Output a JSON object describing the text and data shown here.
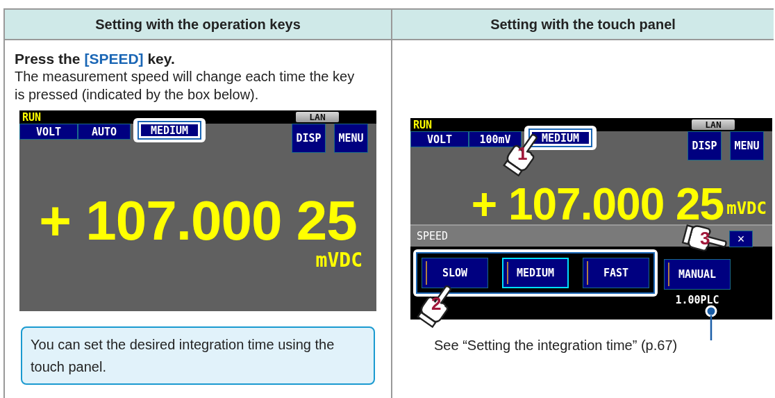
{
  "table": {
    "columns": [
      "Setting with the operation keys",
      "Setting with the touch panel"
    ]
  },
  "left": {
    "instruction": {
      "before": "Press the",
      "key": "[SPEED]",
      "after": "key."
    },
    "description": "The measurement speed will change each time the key is pressed (indicated by the box below).",
    "screen": {
      "status": "RUN",
      "lan": "LAN",
      "tabs": [
        {
          "label": "VOLT",
          "highlighted": false
        },
        {
          "label": "AUTO",
          "highlighted": false
        },
        {
          "label": "MEDIUM",
          "highlighted": true
        }
      ],
      "buttons": [
        "DISP",
        "MENU"
      ],
      "reading": "+ 107.000 25",
      "unit": "mVDC"
    },
    "note": "You can set the desired integration time using the touch panel."
  },
  "right": {
    "screen": {
      "status": "RUN",
      "lan": "LAN",
      "tabs": [
        {
          "label": "VOLT",
          "highlighted": false
        },
        {
          "label": "100mV",
          "highlighted": false
        },
        {
          "label": "MEDIUM",
          "highlighted": true
        }
      ],
      "buttons": [
        "DISP",
        "MENU"
      ],
      "reading": "+ 107.000 25",
      "unit": "mVDC",
      "speed_panel": {
        "title": "SPEED",
        "close": "×",
        "options_highlighted": true,
        "options": [
          {
            "label": "SLOW",
            "selected": false
          },
          {
            "label": "MEDIUM",
            "selected": true
          },
          {
            "label": "FAST",
            "selected": false
          }
        ],
        "manual": "MANUAL",
        "manual_value": "1.00PLC"
      }
    },
    "steps": [
      "1",
      "2",
      "3"
    ],
    "caption": "See “Setting the integration time” (p.67)"
  }
}
